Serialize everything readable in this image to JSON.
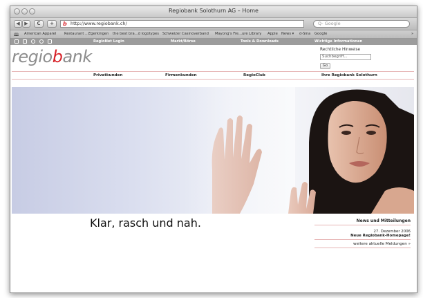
{
  "window": {
    "title": "Regiobank Solothurn AG – Home"
  },
  "toolbar": {
    "back_glyph": "◀",
    "forward_glyph": "▶",
    "reload_glyph": "C",
    "add_glyph": "+",
    "url": "http://www.regiobank.ch/",
    "favicon_letter": "b",
    "search_placeholder": "Q- Google"
  },
  "bookmarks": [
    "American Apparel",
    "Restaurant ...Egerkingen",
    "the best bra...d logotypes",
    "Schweizer Casinoverband",
    "Mayong's Fre...ure Library",
    "Apple",
    "News ▾",
    "d-Sina",
    "Google",
    "»"
  ],
  "sitebar": {
    "items": [
      "RegioNet Login",
      "Markt/Börse",
      "Tools & Downloads",
      "Wichtige Informationen"
    ]
  },
  "header": {
    "logo_prefix": "regio",
    "logo_accent": "b",
    "logo_suffix": "ank",
    "legal_link": "Rechtliche Hinweise",
    "search_placeholder": "Suchbegriff...",
    "go_label": "Go"
  },
  "mainnav": {
    "items": [
      "Privatkunden",
      "Firmenkunden",
      "RegioClub",
      "Ihre Regiobank Solothurn"
    ]
  },
  "hero": {
    "tagline": "Klar, rasch und nah."
  },
  "news": {
    "title": "News und Mitteilungen",
    "date": "27. Dezember 2006",
    "headline": "Neue Regiobank-Homepage!",
    "more": "weitere aktuelle Meldungen »"
  },
  "colors": {
    "accent": "#d8232a",
    "logo_gray": "#8d8d8d",
    "sitebar_gray": "#9c9c9c",
    "rule_pink": "#e6b3b3"
  }
}
